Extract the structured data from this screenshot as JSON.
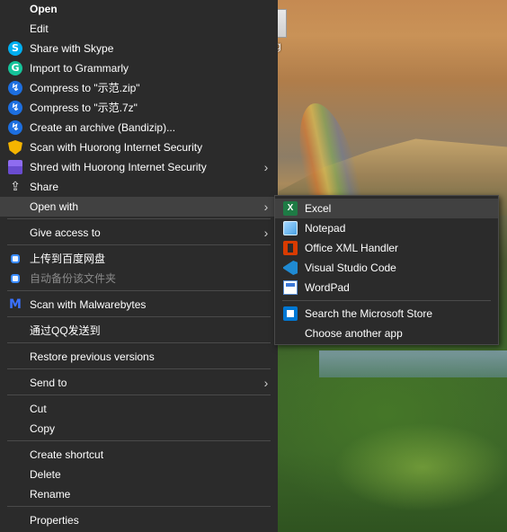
{
  "desktop": {
    "folder_label": "g"
  },
  "context_menu": {
    "items": [
      {
        "label": "Open",
        "icon": "none"
      },
      {
        "label": "Edit",
        "icon": "none"
      },
      {
        "label": "Share with Skype",
        "icon": "skype-icon"
      },
      {
        "label": "Import to Grammarly",
        "icon": "grammarly-icon"
      },
      {
        "label": "Compress to \"示范.zip\"",
        "icon": "bandizip-icon"
      },
      {
        "label": "Compress to \"示范.7z\"",
        "icon": "bandizip-icon"
      },
      {
        "label": "Create an archive (Bandizip)...",
        "icon": "bandizip-icon"
      },
      {
        "label": "Scan with Huorong Internet Security",
        "icon": "huorong-shield-icon"
      },
      {
        "label": "Shred with Huorong Internet Security",
        "icon": "shredder-icon"
      },
      {
        "label": "Share",
        "icon": "share-icon"
      },
      {
        "label": "Open with",
        "icon": "none"
      },
      {
        "label": "Give access to",
        "icon": "none"
      },
      {
        "label": "上传到百度网盘",
        "icon": "baidu-netdisk-icon"
      },
      {
        "label": "自动备份该文件夹",
        "icon": "baidu-netdisk-icon"
      },
      {
        "label": "Scan with Malwarebytes",
        "icon": "malwarebytes-icon"
      },
      {
        "label": "通过QQ发送到",
        "icon": "none"
      },
      {
        "label": "Restore previous versions",
        "icon": "none"
      },
      {
        "label": "Send to",
        "icon": "none"
      },
      {
        "label": "Cut",
        "icon": "none"
      },
      {
        "label": "Copy",
        "icon": "none"
      },
      {
        "label": "Create shortcut",
        "icon": "none"
      },
      {
        "label": "Delete",
        "icon": "none"
      },
      {
        "label": "Rename",
        "icon": "none"
      },
      {
        "label": "Properties",
        "icon": "none"
      }
    ],
    "submenu_arrow": "›"
  },
  "open_with_menu": {
    "items": [
      {
        "label": "Excel",
        "icon": "excel-icon"
      },
      {
        "label": "Notepad",
        "icon": "notepad-icon"
      },
      {
        "label": "Office XML Handler",
        "icon": "office-icon"
      },
      {
        "label": "Visual Studio Code",
        "icon": "vscode-icon"
      },
      {
        "label": "WordPad",
        "icon": "wordpad-icon"
      },
      {
        "label": "Search the Microsoft Store",
        "icon": "microsoft-store-icon"
      },
      {
        "label": "Choose another app",
        "icon": "none"
      }
    ]
  },
  "icon_glyphs": {
    "skype": "S",
    "grammarly": "G",
    "bandizip": "↯",
    "excel": "X",
    "malwarebytes": "M",
    "share": "⇪"
  },
  "colors": {
    "menu_bg": "#2b2b2b",
    "highlight_bg": "#414141",
    "separator": "#4a4a4a",
    "text": "#ffffff",
    "disabled_text": "#8a8a8a"
  }
}
